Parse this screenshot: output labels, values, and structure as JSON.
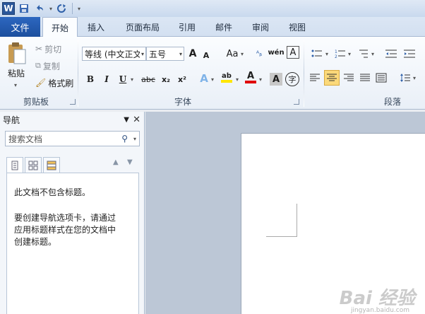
{
  "qat": {
    "logo": "W",
    "undo_icon": "undo-icon",
    "redo_icon": "redo-icon"
  },
  "tabs": {
    "file": "文件",
    "items": [
      "开始",
      "插入",
      "页面布局",
      "引用",
      "邮件",
      "审阅",
      "视图"
    ],
    "active": "开始"
  },
  "ribbon": {
    "clipboard": {
      "paste": "粘贴",
      "cut": "剪切",
      "copy": "复制",
      "format_painter": "格式刷",
      "label": "剪贴板"
    },
    "font": {
      "font_name": "等线 (中文正文",
      "font_size": "五号",
      "grow": "A",
      "shrink": "A",
      "change_case": "Aa",
      "pinyin": "wén",
      "border_char": "A",
      "bold": "B",
      "italic": "I",
      "underline": "U",
      "strike": "abc",
      "subscript": "x₂",
      "superscript": "x²",
      "text_effect": "A",
      "highlight": "ab",
      "font_color": "A",
      "char_shading": "A",
      "enclose": "字",
      "label": "字体"
    },
    "paragraph": {
      "label": "段落"
    }
  },
  "nav": {
    "title": "导航",
    "search_placeholder": "搜索文档",
    "message1": "此文档不包含标题。",
    "message2": "要创建导航选项卡，请通过应用标题样式在您的文档中创建标题。"
  },
  "watermark": {
    "text": "Bai 经验",
    "sub": "jingyan.baidu.com"
  },
  "colors": {
    "accent": "#2b579a",
    "highlight": "#ffe600",
    "font_color": "#e00000",
    "selected_btn": "#fbd97a"
  }
}
